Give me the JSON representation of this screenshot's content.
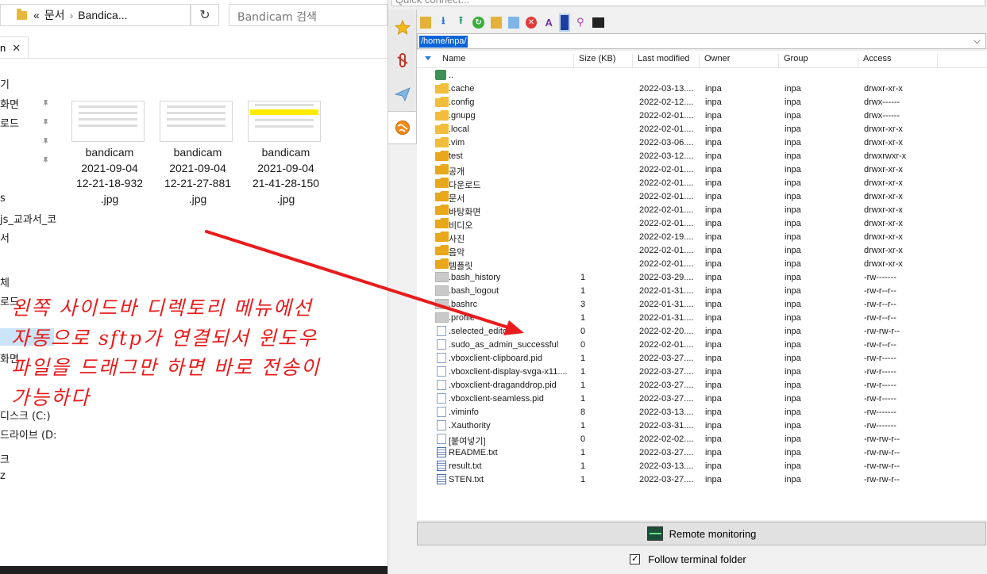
{
  "explorer": {
    "breadcrumb": {
      "prefix": "«",
      "parts": [
        "문서",
        "Bandica..."
      ],
      "sep": "›"
    },
    "refresh_glyph": "↻",
    "search_placeholder": "Bandicam 검색",
    "tab_label": "n",
    "tab_close": "✕",
    "nav_items": [
      {
        "label": "기"
      },
      {
        "label": "화면"
      },
      {
        "label": "로드"
      },
      {
        "label": "s"
      },
      {
        "label": "js_교과서_코"
      },
      {
        "label": "서"
      },
      {
        "label": "체"
      },
      {
        "label": "로드"
      },
      {
        "label": "화면"
      },
      {
        "label": "디스크 (C:)"
      },
      {
        "label": "드라이브 (D:"
      },
      {
        "label": "크"
      },
      {
        "label": "z"
      }
    ],
    "files": [
      {
        "name": "bandicam",
        "line2": "2021-09-04",
        "line3": "12-21-18-932",
        "ext": ".jpg",
        "thumb": "table"
      },
      {
        "name": "bandicam",
        "line2": "2021-09-04",
        "line3": "12-21-27-881",
        "ext": ".jpg",
        "thumb": "table"
      },
      {
        "name": "bandicam",
        "line2": "2021-09-04",
        "line3": "21-41-28-150",
        "ext": ".jpg",
        "thumb": "sheet"
      }
    ]
  },
  "sftp": {
    "quick_connect_placeholder": "Quick connect...",
    "path": "/home/inpa/",
    "columns": [
      "Name",
      "Size (KB)",
      "Last modified",
      "Owner",
      "Group",
      "Access"
    ],
    "rows": [
      {
        "name": "..",
        "size": "",
        "modified": "",
        "owner": "",
        "group": "",
        "access": "",
        "icon": "up"
      },
      {
        "name": ".cache",
        "size": "",
        "modified": "2022-03-13....",
        "owner": "inpa",
        "group": "inpa",
        "access": "drwxr-xr-x",
        "icon": "folder"
      },
      {
        "name": ".config",
        "size": "",
        "modified": "2022-02-12....",
        "owner": "inpa",
        "group": "inpa",
        "access": "drwx------",
        "icon": "folder"
      },
      {
        "name": ".gnupg",
        "size": "",
        "modified": "2022-02-01....",
        "owner": "inpa",
        "group": "inpa",
        "access": "drwx------",
        "icon": "folder"
      },
      {
        "name": ".local",
        "size": "",
        "modified": "2022-02-01....",
        "owner": "inpa",
        "group": "inpa",
        "access": "drwxr-xr-x",
        "icon": "folder"
      },
      {
        "name": ".vim",
        "size": "",
        "modified": "2022-03-06....",
        "owner": "inpa",
        "group": "inpa",
        "access": "drwxr-xr-x",
        "icon": "folder"
      },
      {
        "name": "test",
        "size": "",
        "modified": "2022-03-12....",
        "owner": "inpa",
        "group": "inpa",
        "access": "drwxrwxr-x",
        "icon": "folder-d"
      },
      {
        "name": "공개",
        "size": "",
        "modified": "2022-02-01....",
        "owner": "inpa",
        "group": "inpa",
        "access": "drwxr-xr-x",
        "icon": "folder-d"
      },
      {
        "name": "다운로드",
        "size": "",
        "modified": "2022-02-01....",
        "owner": "inpa",
        "group": "inpa",
        "access": "drwxr-xr-x",
        "icon": "folder-d"
      },
      {
        "name": "문서",
        "size": "",
        "modified": "2022-02-01....",
        "owner": "inpa",
        "group": "inpa",
        "access": "drwxr-xr-x",
        "icon": "folder-d"
      },
      {
        "name": "바탕화면",
        "size": "",
        "modified": "2022-02-01....",
        "owner": "inpa",
        "group": "inpa",
        "access": "drwxr-xr-x",
        "icon": "folder-d"
      },
      {
        "name": "비디오",
        "size": "",
        "modified": "2022-02-01....",
        "owner": "inpa",
        "group": "inpa",
        "access": "drwxr-xr-x",
        "icon": "folder-d"
      },
      {
        "name": "사진",
        "size": "",
        "modified": "2022-02-19....",
        "owner": "inpa",
        "group": "inpa",
        "access": "drwxr-xr-x",
        "icon": "folder-d"
      },
      {
        "name": "음악",
        "size": "",
        "modified": "2022-02-01....",
        "owner": "inpa",
        "group": "inpa",
        "access": "drwxr-xr-x",
        "icon": "folder-d"
      },
      {
        "name": "템플릿",
        "size": "",
        "modified": "2022-02-01....",
        "owner": "inpa",
        "group": "inpa",
        "access": "drwxr-xr-x",
        "icon": "folder-d"
      },
      {
        "name": ".bash_history",
        "size": "1",
        "modified": "2022-03-29....",
        "owner": "inpa",
        "group": "inpa",
        "access": "-rw-------",
        "icon": "gray"
      },
      {
        "name": ".bash_logout",
        "size": "1",
        "modified": "2022-01-31....",
        "owner": "inpa",
        "group": "inpa",
        "access": "-rw-r--r--",
        "icon": "gray"
      },
      {
        "name": ".bashrc",
        "size": "3",
        "modified": "2022-01-31....",
        "owner": "inpa",
        "group": "inpa",
        "access": "-rw-r--r--",
        "icon": "gray"
      },
      {
        "name": ".profile",
        "size": "1",
        "modified": "2022-01-31....",
        "owner": "inpa",
        "group": "inpa",
        "access": "-rw-r--r--",
        "icon": "gray"
      },
      {
        "name": ".selected_editor",
        "size": "0",
        "modified": "2022-02-20....",
        "owner": "inpa",
        "group": "inpa",
        "access": "-rw-rw-r--",
        "icon": "doc"
      },
      {
        "name": ".sudo_as_admin_successful",
        "size": "0",
        "modified": "2022-02-01....",
        "owner": "inpa",
        "group": "inpa",
        "access": "-rw-r--r--",
        "icon": "doc"
      },
      {
        "name": ".vboxclient-clipboard.pid",
        "size": "1",
        "modified": "2022-03-27....",
        "owner": "inpa",
        "group": "inpa",
        "access": "-rw-r-----",
        "icon": "doc"
      },
      {
        "name": ".vboxclient-display-svga-x11....",
        "size": "1",
        "modified": "2022-03-27....",
        "owner": "inpa",
        "group": "inpa",
        "access": "-rw-r-----",
        "icon": "doc"
      },
      {
        "name": ".vboxclient-draganddrop.pid",
        "size": "1",
        "modified": "2022-03-27....",
        "owner": "inpa",
        "group": "inpa",
        "access": "-rw-r-----",
        "icon": "doc"
      },
      {
        "name": ".vboxclient-seamless.pid",
        "size": "1",
        "modified": "2022-03-27....",
        "owner": "inpa",
        "group": "inpa",
        "access": "-rw-r-----",
        "icon": "doc"
      },
      {
        "name": ".viminfo",
        "size": "8",
        "modified": "2022-03-13....",
        "owner": "inpa",
        "group": "inpa",
        "access": "-rw-------",
        "icon": "doc"
      },
      {
        "name": ".Xauthority",
        "size": "1",
        "modified": "2022-03-31....",
        "owner": "inpa",
        "group": "inpa",
        "access": "-rw-------",
        "icon": "doc"
      },
      {
        "name": "[붙여넣기]",
        "size": "0",
        "modified": "2022-02-02....",
        "owner": "inpa",
        "group": "inpa",
        "access": "-rw-rw-r--",
        "icon": "doc"
      },
      {
        "name": "README.txt",
        "size": "1",
        "modified": "2022-03-27....",
        "owner": "inpa",
        "group": "inpa",
        "access": "-rw-rw-r--",
        "icon": "txt"
      },
      {
        "name": "result.txt",
        "size": "1",
        "modified": "2022-03-13....",
        "owner": "inpa",
        "group": "inpa",
        "access": "-rw-rw-r--",
        "icon": "txt"
      },
      {
        "name": "STEN.txt",
        "size": "1",
        "modified": "2022-03-27....",
        "owner": "inpa",
        "group": "inpa",
        "access": "-rw-rw-r--",
        "icon": "txt"
      }
    ],
    "remote_monitoring_label": "Remote monitoring",
    "follow_terminal_label": "Follow terminal folder",
    "follow_terminal_checked": "✓"
  },
  "annotation": {
    "lines": [
      "왼쪽 사이드바 디렉토리 메뉴에선",
      "자동으로 sftp가 연결되서 윈도우",
      "파일을 드래그만 하면 바로 전송이",
      "가능하다"
    ],
    "color": "#e81c1c"
  }
}
